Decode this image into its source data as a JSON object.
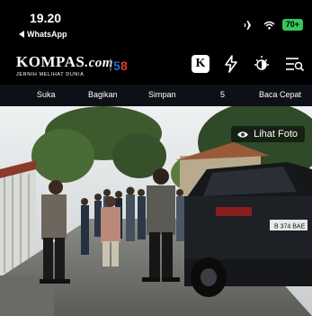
{
  "status": {
    "time": "19.20",
    "back_label": "WhatsApp",
    "battery": "70+"
  },
  "header": {
    "logo_main": "KOMPAS",
    "logo_domain": ".com",
    "logo_tagline": "JERNIH MELIHAT DUNIA",
    "k_label": "K"
  },
  "actions": {
    "like": "Suka",
    "share": "Bagikan",
    "save": "Simpan",
    "count": "5",
    "read": "Baca Cepat"
  },
  "photo": {
    "view_label": "Lihat Foto",
    "plate": "B 374 BAE"
  },
  "colors": {
    "battery": "#35c759",
    "accent_blue": "#1b6fd6",
    "accent_red": "#e23b2e"
  }
}
